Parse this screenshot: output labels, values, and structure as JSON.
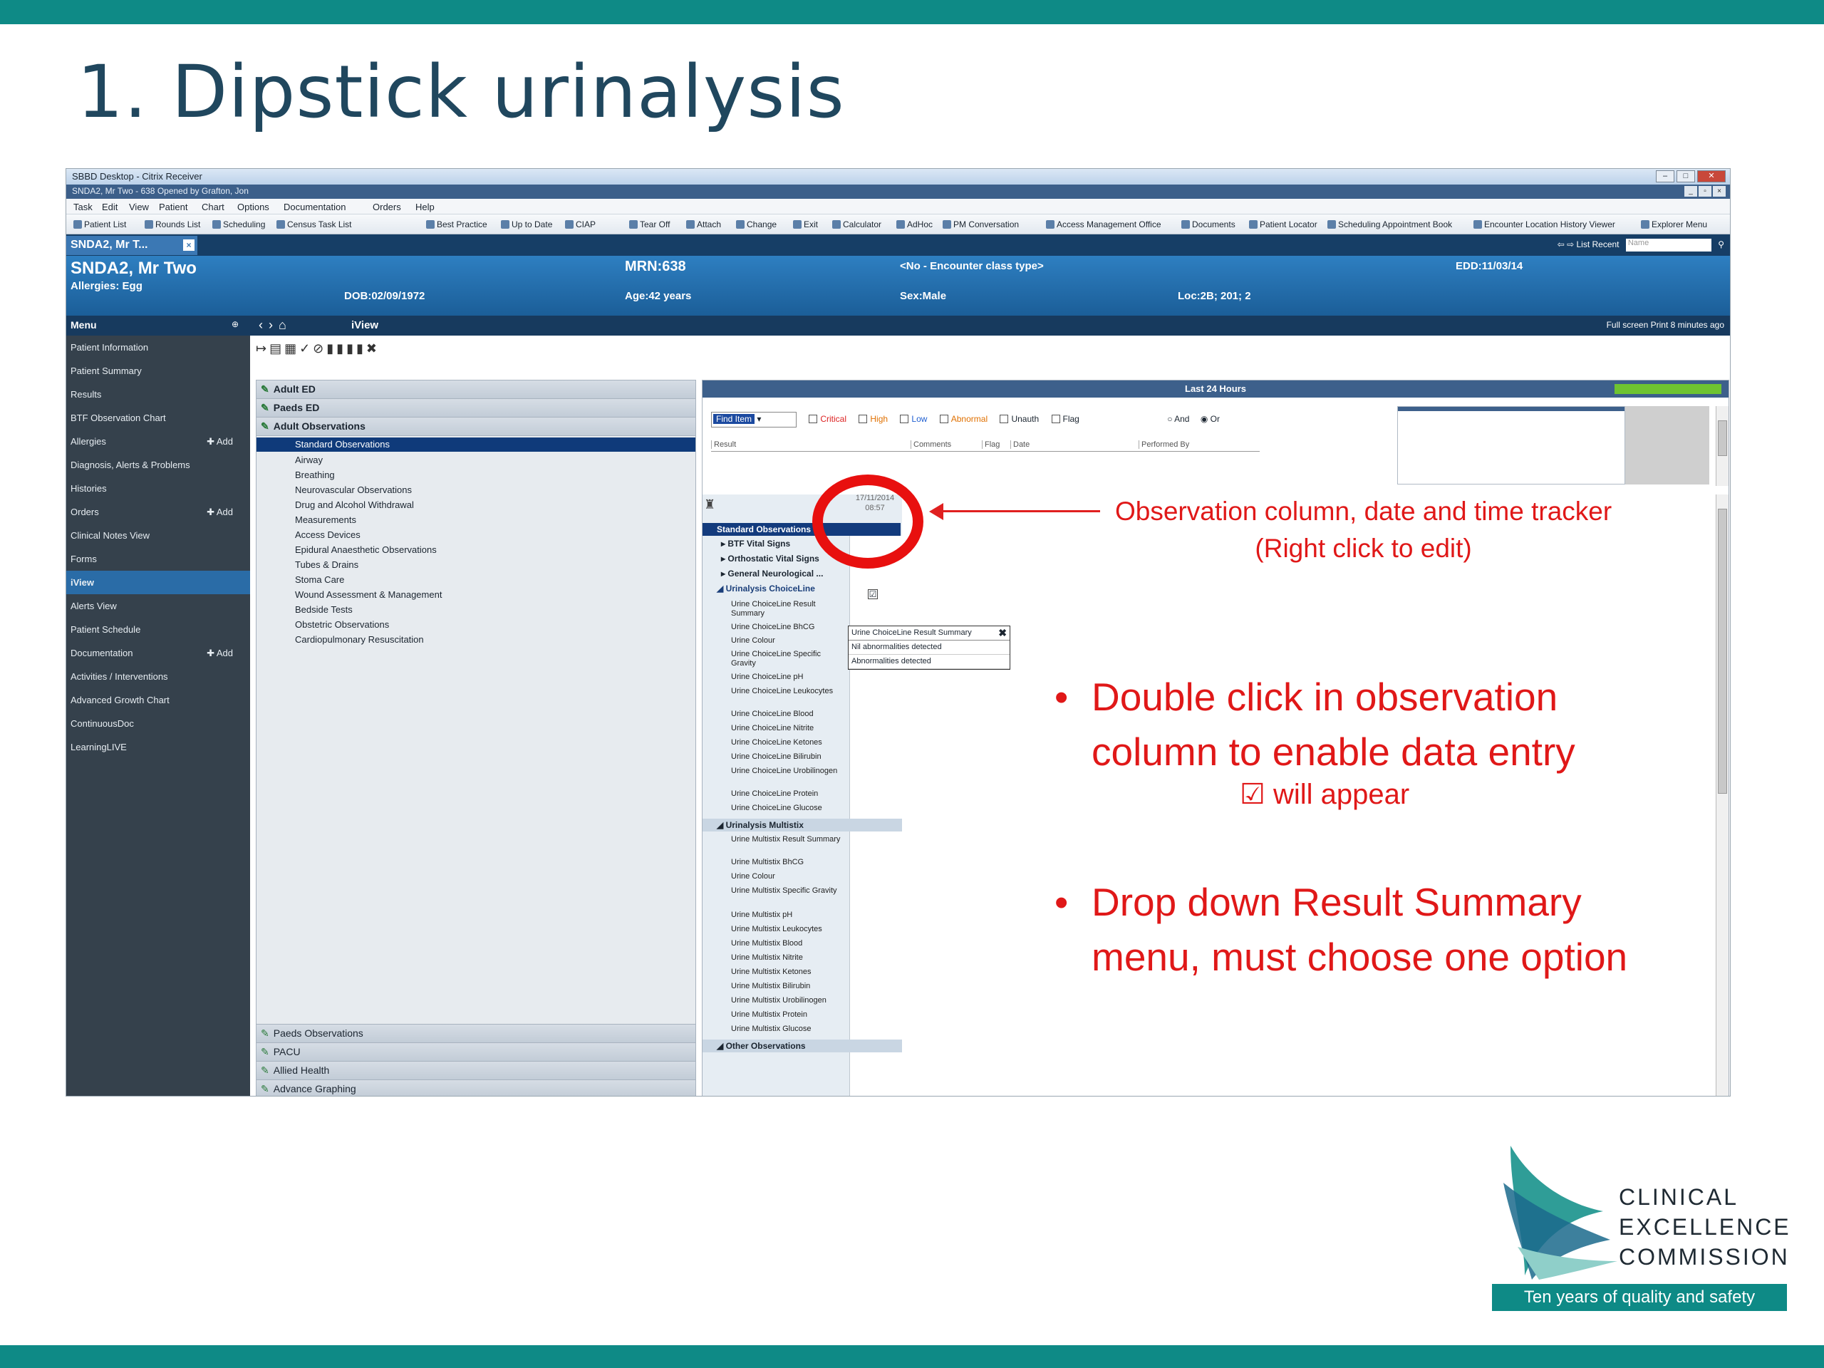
{
  "slide": {
    "title": "1. Dipstick urinalysis",
    "brand_color": "#0e8a86",
    "annotation_color": "#e01818"
  },
  "citrix": {
    "title": "SBBD Desktop - Citrix Receiver",
    "inner_title": "SNDA2, Mr Two - 638 Opened by Grafton, Jon"
  },
  "menubar": [
    "Task",
    "Edit",
    "View",
    "Patient",
    "Chart",
    "Options",
    "Documentation",
    "Orders",
    "Help"
  ],
  "toolbar": [
    "Patient List",
    "Rounds List",
    "Scheduling",
    "Census Task List",
    "Best Practice",
    "Up to Date",
    "CIAP",
    "Tear Off",
    "Attach",
    "Change",
    "Exit",
    "Calculator",
    "AdHoc",
    "PM Conversation",
    "Access Management Office",
    "Documents",
    "Patient Locator",
    "Scheduling Appointment Book",
    "Encounter Location History Viewer",
    "Explorer Menu"
  ],
  "tab": {
    "label": "SNDA2, Mr T...",
    "right": "List   Recent",
    "search_placeholder": "Name"
  },
  "banner": {
    "name": "SNDA2, Mr Two",
    "allergies": "Allergies: Egg",
    "dob": "DOB:02/09/1972",
    "mrn": "MRN:638",
    "age": "Age:42 years",
    "encounter": "<No - Encounter class type>",
    "sex": "Sex:Male",
    "loc": "Loc:2B; 201; 2",
    "edd": "EDD:11/03/14"
  },
  "nav": {
    "menu_label": "Menu",
    "page_title": "iView",
    "right": "Full screen   Print   8 minutes ago"
  },
  "sidebar": [
    {
      "label": "Patient Information"
    },
    {
      "label": "Patient Summary"
    },
    {
      "label": "Results"
    },
    {
      "label": "BTF Observation Chart"
    },
    {
      "label": "Allergies",
      "add": "Add"
    },
    {
      "label": "Diagnosis, Alerts & Problems"
    },
    {
      "label": "Histories"
    },
    {
      "label": "Orders",
      "add": "Add"
    },
    {
      "label": "Clinical Notes View"
    },
    {
      "label": "Forms"
    },
    {
      "label": "iView"
    },
    {
      "label": "Alerts View"
    },
    {
      "label": "Patient Schedule"
    },
    {
      "label": "Documentation",
      "add": "Add"
    },
    {
      "label": "Activities / Interventions"
    },
    {
      "label": "Advanced Growth Chart"
    },
    {
      "label": "ContinuousDoc"
    },
    {
      "label": "LearningLIVE"
    }
  ],
  "left_panel": {
    "groups": [
      "Adult ED",
      "Paeds ED",
      "Adult Observations"
    ],
    "items": [
      "Standard Observations",
      "Airway",
      "Breathing",
      "Neurovascular Observations",
      "Drug and Alcohol Withdrawal",
      "Measurements",
      "Access Devices",
      "Epidural Anaesthetic Observations",
      "Tubes & Drains",
      "Stoma Care",
      "Wound Assessment & Management",
      "Bedside Tests",
      "Obstetric Observations",
      "Cardiopulmonary Resuscitation"
    ],
    "lower_groups": [
      "Paeds Observations",
      "PACU",
      "Allied Health",
      "Advance Graphing"
    ]
  },
  "right_panel": {
    "header": "Last 24 Hours",
    "find_item": "Find Item",
    "filters": [
      "Critical",
      "High",
      "Low",
      "Abnormal",
      "Unauth",
      "Flag"
    ],
    "and_label": "And",
    "or_label": "Or",
    "grid_cols": [
      "Result",
      "Comments",
      "Flag",
      "Date",
      "Performed By"
    ],
    "date": "17/11/2014",
    "time": "08:57",
    "obs_header": "Standard Observations",
    "obs_groups": [
      "BTF Vital Signs",
      "Orthostatic Vital Signs",
      "General Neurological ..."
    ],
    "choiceline_section": "Urinalysis ChoiceLine",
    "choiceline_items": [
      "Urine ChoiceLine Result Summary",
      "Urine ChoiceLine BhCG",
      "Urine Colour",
      "Urine ChoiceLine Specific Gravity",
      "Urine ChoiceLine pH",
      "Urine ChoiceLine Leukocytes",
      "Urine ChoiceLine Blood",
      "Urine ChoiceLine Nitrite",
      "Urine ChoiceLine Ketones",
      "Urine ChoiceLine Bilirubin",
      "Urine ChoiceLine Urobilinogen",
      "Urine ChoiceLine Protein",
      "Urine ChoiceLine Glucose"
    ],
    "multistix_section": "Urinalysis Multistix",
    "multistix_items": [
      "Urine Multistix Result Summary",
      "Urine Multistix BhCG",
      "Urine Colour",
      "Urine Multistix Specific Gravity",
      "Urine Multistix pH",
      "Urine Multistix Leukocytes",
      "Urine Multistix Blood",
      "Urine Multistix Nitrite",
      "Urine Multistix Ketones",
      "Urine Multistix Bilirubin",
      "Urine Multistix Urobilinogen",
      "Urine Multistix Protein",
      "Urine Multistix Glucose"
    ],
    "other_section": "Other Observations",
    "checkbox": "☑",
    "dropdown": {
      "title": "Urine ChoiceLine Result Summary",
      "options": [
        "Nil abnormalities detected",
        "Abnormalities detected"
      ]
    }
  },
  "annotations": {
    "tracker_line1": "Observation column, date and time tracker",
    "tracker_line2": "(Right click to edit)",
    "bullet1_line1": "Double click in observation",
    "bullet1_line2": "column to enable data entry",
    "will_appear": "☑ will appear",
    "bullet2_line1": "Drop down Result Summary",
    "bullet2_line2": "menu, must choose one option",
    "bullet_char": "•"
  },
  "logo": {
    "line1": "CLINICAL",
    "line2": "EXCELLENCE",
    "line3": "COMMISSION",
    "tagline": "Ten years of quality and safety"
  }
}
